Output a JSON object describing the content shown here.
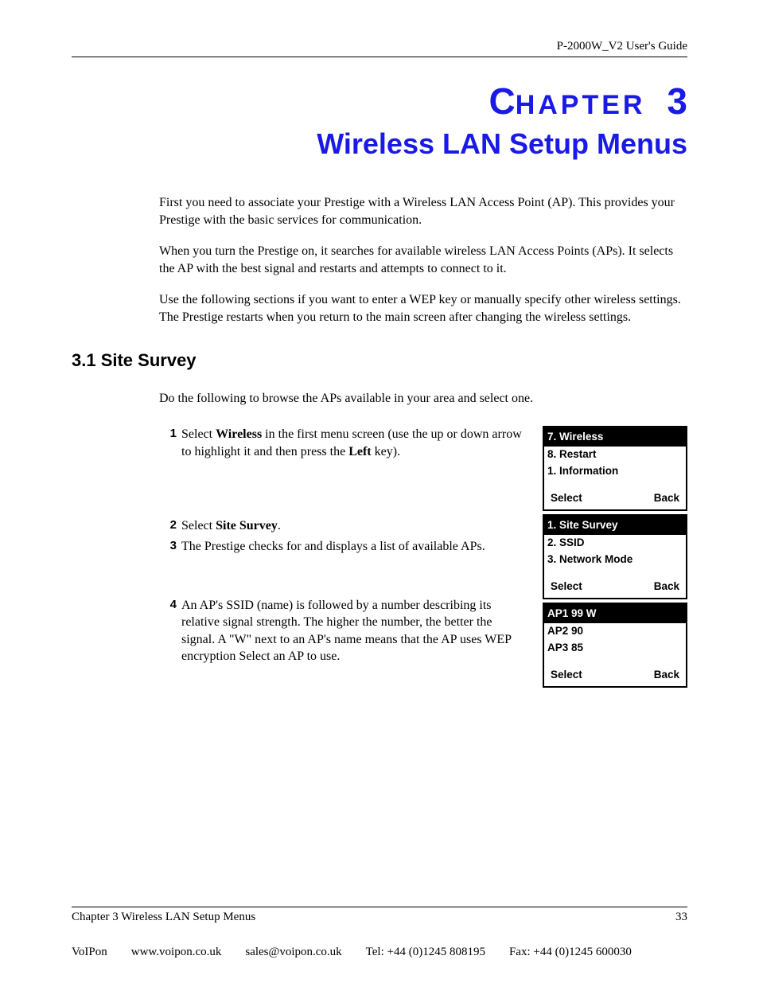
{
  "header": {
    "doc_title": "P-2000W_V2 User's Guide"
  },
  "chapter": {
    "label_word": "CHAPTER",
    "label_c": "C",
    "label_rest": "HAPTER",
    "number": "3",
    "title": "Wireless LAN Setup Menus"
  },
  "intro": {
    "p1": "First you need to associate your Prestige with a Wireless LAN Access Point (AP). This provides your Prestige with the basic services for communication.",
    "p2": "When you turn the Prestige on, it searches for available wireless LAN Access Points (APs). It selects the AP with the best signal and restarts and attempts to connect to it.",
    "p3": "Use the following sections if you want to enter a WEP key or manually specify other wireless settings. The Prestige restarts when you return to the main screen after changing the wireless settings."
  },
  "section": {
    "heading": "3.1  Site Survey",
    "intro": "Do the following to browse the APs available in your area and select one."
  },
  "steps": {
    "s1_num": "1",
    "s1_a": "Select ",
    "s1_b": "Wireless",
    "s1_c": " in the first menu screen (use the up or down arrow to highlight it and then press the ",
    "s1_d": "Left",
    "s1_e": " key).",
    "s2_num": "2",
    "s2_a": "Select ",
    "s2_b": "Site Survey",
    "s2_c": ".",
    "s3_num": "3",
    "s3_text": "The Prestige checks for and displays a list of available APs.",
    "s4_num": "4",
    "s4_text": "An AP's SSID (name) is followed by a number describing its relative signal strength. The higher the number, the better the signal. A \"W\" next to an AP's name means that the AP uses WEP encryption  Select an AP to use."
  },
  "screens": {
    "scr1": {
      "hl": "7. Wireless",
      "i1": "8. Restart",
      "i2": "1. Information",
      "fL": "Select",
      "fR": "Back"
    },
    "scr2": {
      "hl": "1. Site Survey",
      "i1": "2. SSID",
      "i2": "3. Network Mode",
      "fL": "Select",
      "fR": "Back"
    },
    "scr3": {
      "hl": "AP1 99 W",
      "i1": "AP2 90",
      "i2": "AP3 85",
      "fL": "Select",
      "fR": "Back"
    }
  },
  "footer": {
    "chapter_ref": "Chapter 3 Wireless LAN Setup Menus",
    "page_num": "33",
    "company": "VoIPon",
    "web": "www.voipon.co.uk",
    "email": "sales@voipon.co.uk",
    "tel": "Tel: +44 (0)1245 808195",
    "fax": "Fax: +44 (0)1245 600030"
  }
}
